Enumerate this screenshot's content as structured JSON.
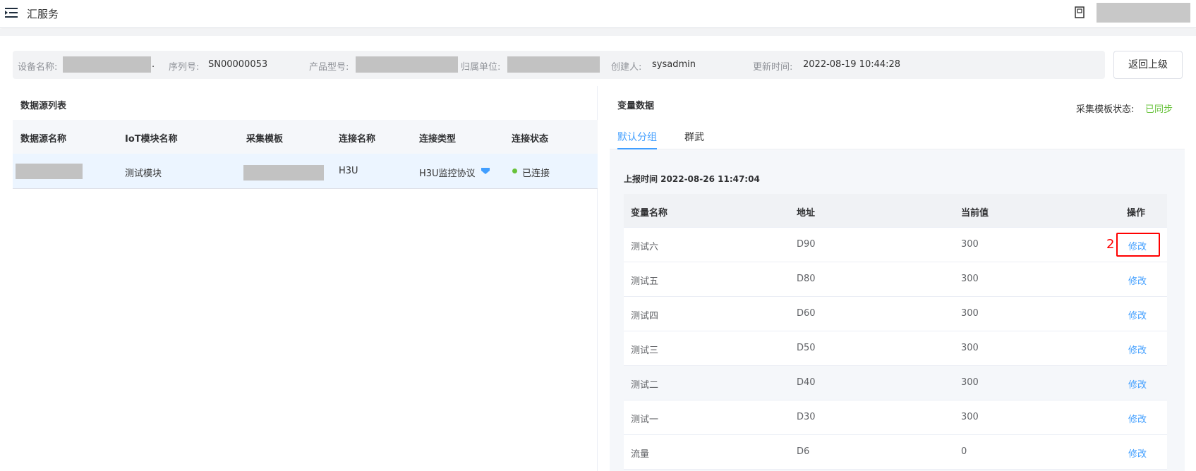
{
  "header": {
    "app_title": "汇服务",
    "menu_icon": "menu-icon",
    "book_icon": "book-icon"
  },
  "device_info": {
    "name_label": "设备名称:",
    "name_suffix": ".",
    "serial_label": "序列号:",
    "serial_value": "SN00000053",
    "model_label": "产品型号:",
    "org_label": "归属单位:",
    "creator_label": "创建人:",
    "creator_value": "sysadmin",
    "updated_label": "更新时间:",
    "updated_value": "2022-08-19 10:44:28",
    "back_button": "返回上级"
  },
  "datasource_panel": {
    "title": "数据源列表",
    "columns": [
      "数据源名称",
      "IoT模块名称",
      "采集模板",
      "连接名称",
      "连接类型",
      "连接状态"
    ],
    "rows": [
      {
        "iot_module": "测试模块",
        "connection_name": "H3U",
        "connection_type": "H3U监控协议",
        "status": "已连接"
      }
    ]
  },
  "variable_panel": {
    "title": "变量数据",
    "sync_label": "采集模板状态:",
    "sync_value": "已同步",
    "tabs": [
      {
        "label": "默认分组",
        "active": true
      },
      {
        "label": "群武",
        "active": false
      }
    ],
    "report_time": "上报时间 2022-08-26 11:47:04",
    "columns": [
      "变量名称",
      "地址",
      "当前值",
      "操作"
    ],
    "rows": [
      {
        "name": "测试六",
        "address": "D90",
        "value": "300",
        "action": "修改"
      },
      {
        "name": "测试五",
        "address": "D80",
        "value": "300",
        "action": "修改"
      },
      {
        "name": "测试四",
        "address": "D60",
        "value": "300",
        "action": "修改"
      },
      {
        "name": "测试三",
        "address": "D50",
        "value": "300",
        "action": "修改"
      },
      {
        "name": "测试二",
        "address": "D40",
        "value": "300",
        "action": "修改"
      },
      {
        "name": "测试一",
        "address": "D30",
        "value": "300",
        "action": "修改"
      },
      {
        "name": "流量",
        "address": "D6",
        "value": "0",
        "action": "修改"
      }
    ],
    "annotation_number": "2"
  },
  "colors": {
    "accent": "#409eff",
    "success": "#67c23a",
    "annotation": "#ff0000"
  }
}
